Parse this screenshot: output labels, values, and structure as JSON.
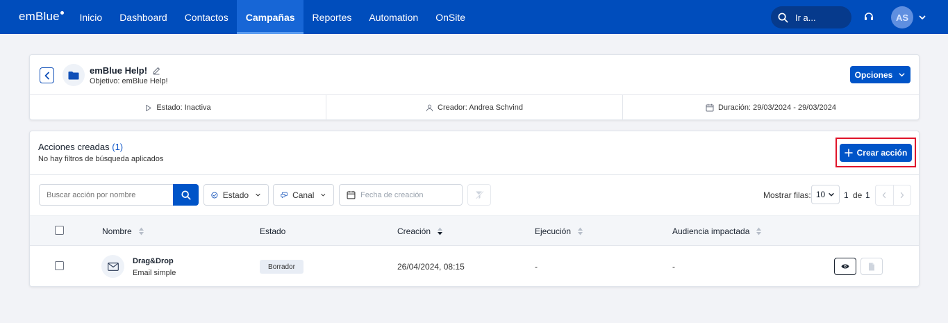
{
  "topbar": {
    "logo": "emBlue",
    "nav": [
      "Inicio",
      "Dashboard",
      "Contactos",
      "Campañas",
      "Reportes",
      "Automation",
      "OnSite"
    ],
    "active_nav": "Campañas",
    "search_label": "Ir a...",
    "avatar_initials": "AS"
  },
  "campaign": {
    "title": "emBlue Help!",
    "objective": "Objetivo: emBlue Help!",
    "options_label": "Opciones",
    "status": "Estado: Inactiva",
    "creator": "Creador: Andrea Schvind",
    "duration": "Duración: 29/03/2024 - 29/03/2024"
  },
  "actions": {
    "title": "Acciones creadas",
    "count": "(1)",
    "subtitle": "No hay filtros de búsqueda aplicados",
    "create_label": "Crear acción",
    "search_placeholder": "Buscar acción por nombre",
    "filter_estado": "Estado",
    "filter_canal": "Canal",
    "filter_fecha": "Fecha de creación",
    "rows_label": "Mostrar filas:",
    "rows_value": "10",
    "page_current": "1",
    "page_of": "de",
    "page_total": "1"
  },
  "table": {
    "columns": [
      "Nombre",
      "Estado",
      "Creación",
      "Ejecución",
      "Audiencia impactada"
    ],
    "rows": [
      {
        "name": "Drag&Drop",
        "type": "Email simple",
        "status": "Borrador",
        "created": "26/04/2024, 08:15",
        "execution": "-",
        "audience": "-"
      }
    ]
  },
  "colors": {
    "topbar": "#004dbc",
    "primary_button": "#0054c8",
    "highlight": "#e0142a"
  }
}
